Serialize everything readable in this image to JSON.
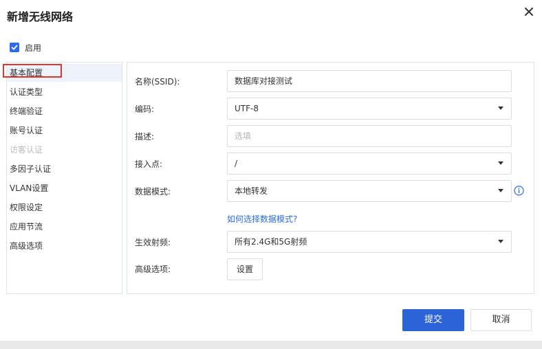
{
  "dialog": {
    "title": "新增无线网络",
    "close_icon": "close-icon",
    "enable": {
      "label": "启用",
      "checked": true
    }
  },
  "sidebar": {
    "items": [
      {
        "label": "基本配置",
        "active": true,
        "disabled": false
      },
      {
        "label": "认证类型",
        "active": false,
        "disabled": false
      },
      {
        "label": "终端验证",
        "active": false,
        "disabled": false
      },
      {
        "label": "账号认证",
        "active": false,
        "disabled": false
      },
      {
        "label": "访客认证",
        "active": false,
        "disabled": true
      },
      {
        "label": "多因子认证",
        "active": false,
        "disabled": false
      },
      {
        "label": "VLAN设置",
        "active": false,
        "disabled": false
      },
      {
        "label": "权限设定",
        "active": false,
        "disabled": false
      },
      {
        "label": "应用节流",
        "active": false,
        "disabled": false
      },
      {
        "label": "高级选项",
        "active": false,
        "disabled": false
      }
    ]
  },
  "form": {
    "ssid": {
      "label": "名称(SSID):",
      "value": "数据库对接测试"
    },
    "encoding": {
      "label": "编码:",
      "value": "UTF-8"
    },
    "description": {
      "label": "描述:",
      "value": "",
      "placeholder": "选填"
    },
    "access_point": {
      "label": "接入点:",
      "value": "/"
    },
    "data_mode": {
      "label": "数据模式:",
      "value": "本地转发"
    },
    "data_mode_help_link": "如何选择数据模式?",
    "radio": {
      "label": "生效射频:",
      "value": "所有2.4G和5G射频"
    },
    "advanced": {
      "label": "高级选项:",
      "button": "设置"
    }
  },
  "footer": {
    "submit": "提交",
    "cancel": "取消"
  },
  "colors": {
    "accent": "#2c63d6",
    "highlight_outline": "#e0352b",
    "sidebar_active_bg": "#edf2fb",
    "disabled_text": "#bbbbbb"
  }
}
